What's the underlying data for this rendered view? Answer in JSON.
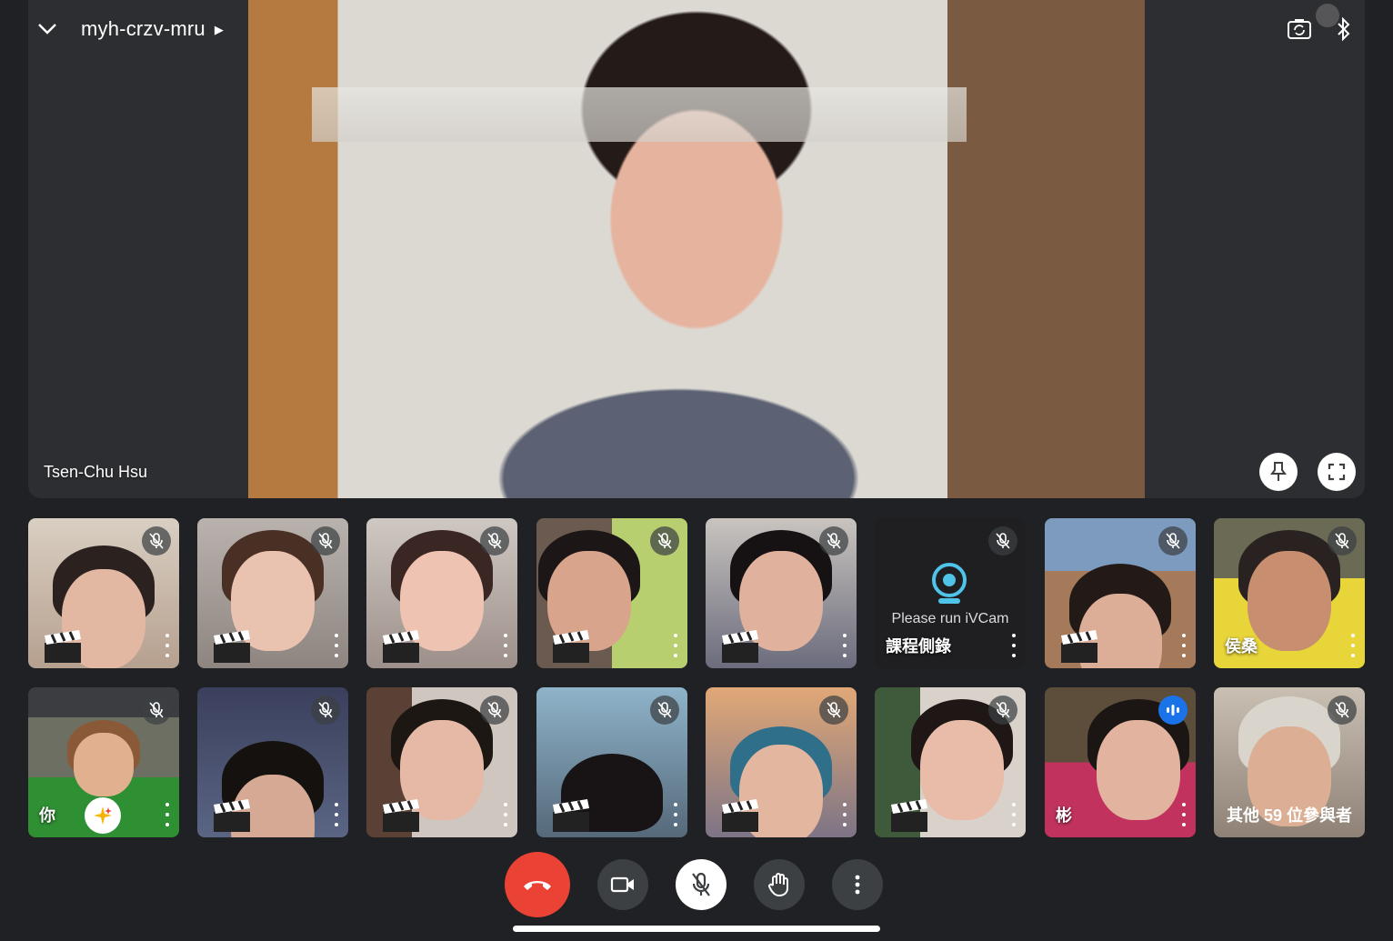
{
  "meeting": {
    "code": "myh-crzv-mru",
    "active_speaker": "Tsen-Chu Hsu"
  },
  "icons": {
    "collapse": "chevron-down-icon",
    "switch_camera": "switch-camera-icon",
    "bluetooth": "bluetooth-icon",
    "pin": "pin-icon",
    "fullscreen": "fullscreen-icon"
  },
  "participants_row1": [
    {
      "name": "",
      "muted": true,
      "placeholder_label": ""
    },
    {
      "name": "",
      "muted": true
    },
    {
      "name": "",
      "muted": true
    },
    {
      "name": "",
      "muted": true
    },
    {
      "name": "",
      "muted": true
    },
    {
      "name": "課程側錄",
      "muted": true,
      "placeholder_label": "Please run iVCam"
    },
    {
      "name": "",
      "muted": true
    },
    {
      "name": "侯桑",
      "muted": true
    }
  ],
  "participants_row2": [
    {
      "name": "你",
      "muted": true
    },
    {
      "name": "",
      "muted": true
    },
    {
      "name": "",
      "muted": true
    },
    {
      "name": "",
      "muted": true
    },
    {
      "name": "",
      "muted": true
    },
    {
      "name": "",
      "muted": true
    },
    {
      "name": "彬",
      "muted": false,
      "speaking": true
    },
    {
      "name": "",
      "muted": true,
      "others_label": "其他 59 位參與者"
    }
  ],
  "colors": {
    "background": "#202124",
    "end_call": "#ea4335",
    "speaking": "#1a73e8"
  }
}
